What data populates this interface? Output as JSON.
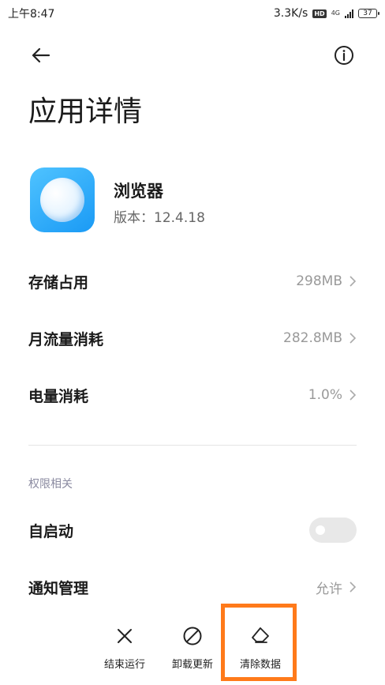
{
  "status_bar": {
    "time": "上午8:47",
    "speed": "3.3K/s",
    "hd": "HD",
    "network": "4G",
    "battery": "37"
  },
  "page": {
    "title": "应用详情"
  },
  "app": {
    "name": "浏览器",
    "version": "版本：12.4.18"
  },
  "rows": {
    "storage": {
      "label": "存储占用",
      "value": "298MB"
    },
    "data": {
      "label": "月流量消耗",
      "value": "282.8MB"
    },
    "battery": {
      "label": "电量消耗",
      "value": "1.0%"
    }
  },
  "permissions": {
    "section_label": "权限相关",
    "autostart": {
      "label": "自启动",
      "enabled": false
    },
    "notifications": {
      "label": "通知管理",
      "value": "允许"
    }
  },
  "actions": {
    "force_stop": "结束运行",
    "uninstall_updates": "卸载更新",
    "clear_data": "清除数据"
  },
  "colors": {
    "highlight": "#ff7a1a",
    "app_icon": "#1a9af5"
  }
}
